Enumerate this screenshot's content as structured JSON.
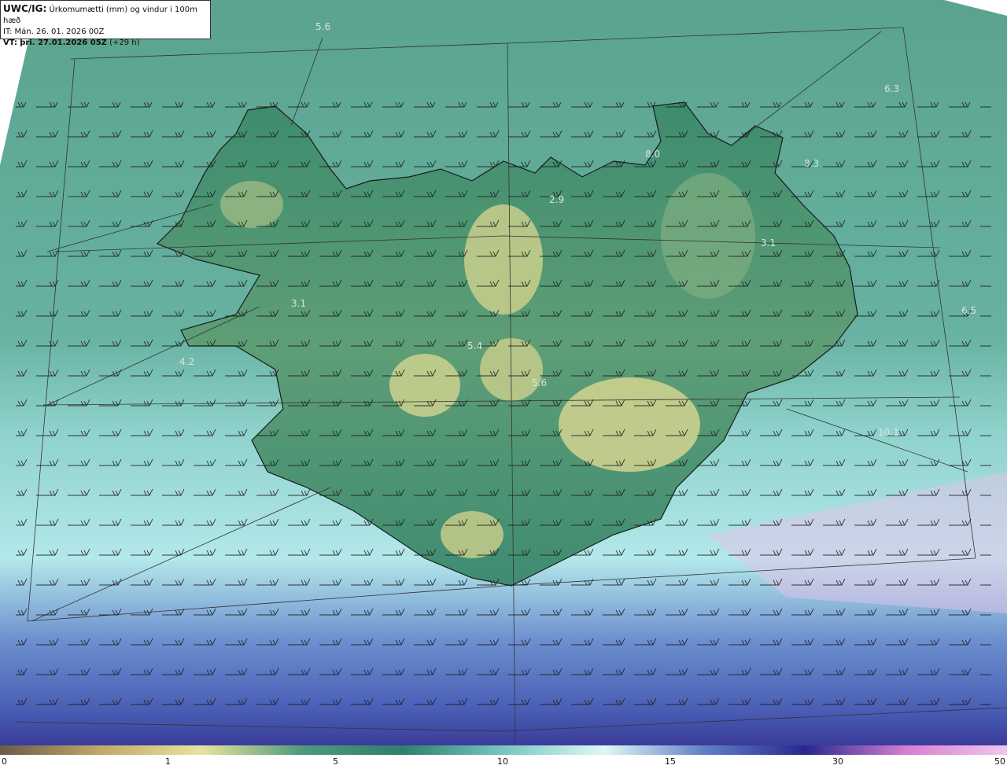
{
  "header": {
    "model": "UWC/IG:",
    "title": "Úrkomumætti (mm) og vindur i 100m hæð",
    "it_label": "IT:",
    "it_value": "Mán. 26. 01. 2026 00Z",
    "vt_label": "VT:",
    "vt_value": "þri. 27.01.2026 05Z",
    "vt_offset": "(+29 h)"
  },
  "map_labels": [
    "5.6",
    "6.3",
    "8.0",
    "8.3",
    "3.1",
    "6.5",
    "10.1",
    "5.4",
    "5.6",
    "4.2",
    "3.1",
    "2.9"
  ],
  "colorbar": {
    "ticks": [
      "0",
      "1",
      "5",
      "10",
      "15",
      "30",
      "50"
    ],
    "colors": [
      "#6b5a48",
      "#c2a86a",
      "#e7e3a0",
      "#4f9a7c",
      "#2f7f6f",
      "#77c6c0",
      "#dff8f6",
      "#5f7fc6",
      "#28288e",
      "#d77fd0",
      "#f0c6ef"
    ]
  }
}
